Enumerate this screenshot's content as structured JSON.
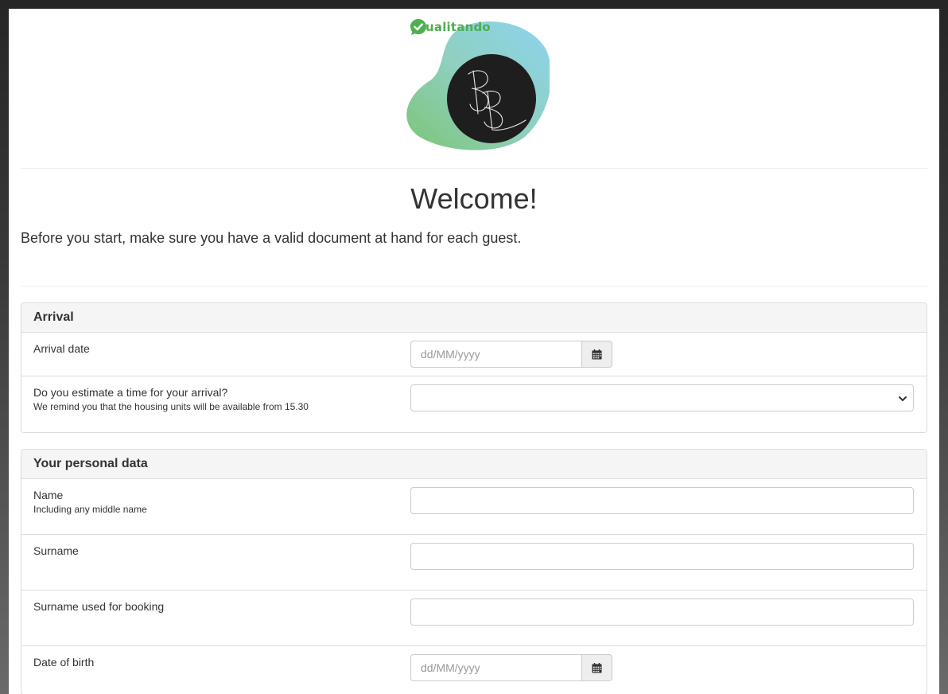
{
  "brand": {
    "name": "ualitando",
    "color": "#4caf50"
  },
  "logo": {
    "monogram": "BB"
  },
  "header": {
    "title": "Welcome!",
    "intro": "Before you start, make sure you have a valid document at hand for each guest."
  },
  "arrival": {
    "heading": "Arrival",
    "date_label": "Arrival date",
    "date_placeholder": "dd/MM/yyyy",
    "time_label": "Do you estimate a time for your arrival?",
    "time_help": "We remind you that the housing units will be available from 15.30",
    "time_value": ""
  },
  "personal": {
    "heading": "Your personal data",
    "name_label": "Name",
    "name_help": "Including any middle name",
    "name_value": "",
    "surname_label": "Surname",
    "surname_value": "",
    "booking_surname_label": "Surname used for booking",
    "booking_surname_value": "",
    "dob_label": "Date of birth",
    "dob_placeholder": "dd/MM/yyyy"
  },
  "icons": {
    "calendar": "calendar-icon",
    "chevron": "chevron-down-icon",
    "check": "check-bubble-icon"
  }
}
